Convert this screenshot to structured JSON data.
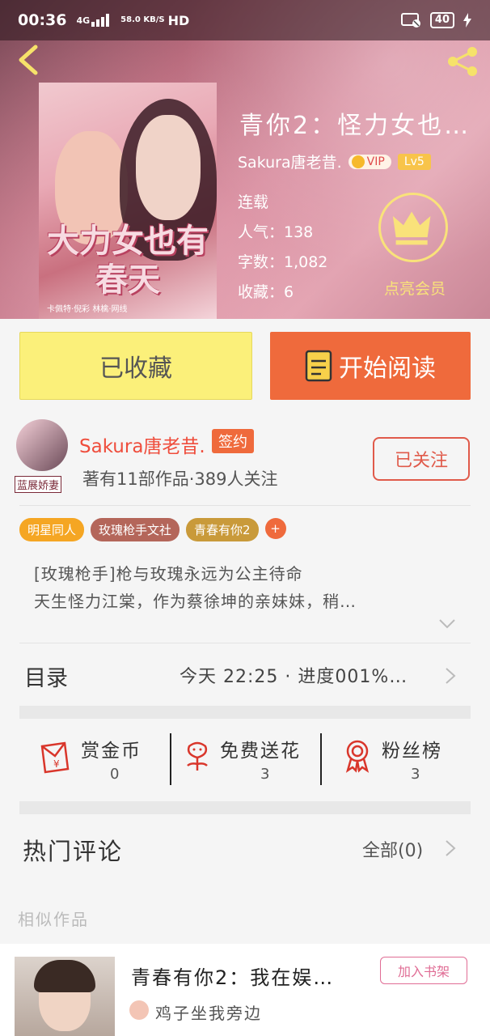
{
  "status_bar": {
    "time": "00:36",
    "network": "4G",
    "speed": "58.0 KB/S",
    "hd": "HD",
    "battery": "40"
  },
  "book": {
    "title": "青你2：怪力女也…",
    "cover_title": "大力女也有春天",
    "cover_credits": "卡佩特·倪彩   林檎·网线",
    "author": "Sakura唐老昔.",
    "vip_label": "VIP",
    "level": "Lv5",
    "status": "连载",
    "popularity": "人气：138",
    "word_count": "字数：1,082",
    "favorites": "收藏：6",
    "member_label": "点亮会员"
  },
  "actions": {
    "collected": "已收藏",
    "start_reading": "开始阅读"
  },
  "author_section": {
    "avatar_tag": "蓝展娇妻",
    "name": "Sakura唐老昔.",
    "signed": "签约",
    "stats": "著有11部作品·389人关注",
    "follow": "已关注"
  },
  "tags": [
    {
      "label": "明星同人",
      "color": "#f5a623"
    },
    {
      "label": "玫瑰枪手文社",
      "color": "#b4665a"
    },
    {
      "label": "青春有你2",
      "color": "#c99a3a"
    }
  ],
  "tag_plus": "+",
  "intro": {
    "line1": "[玫瑰枪手]枪与玫瑰永远为公主待命",
    "line2": "天生怪力江棠，作为蔡徐坤的亲妹妹，稍…"
  },
  "toc": {
    "label": "目录",
    "info": "今天 22:25 · 进度001%…"
  },
  "stats": [
    {
      "label": "赏金币",
      "value": "0",
      "icon": "red-envelope-icon"
    },
    {
      "label": "免费送花",
      "value": "3",
      "icon": "flower-icon"
    },
    {
      "label": "粉丝榜",
      "value": "3",
      "icon": "medal-icon"
    }
  ],
  "comments": {
    "label": "热门评论",
    "all": "全部(0)"
  },
  "similar": {
    "label": "相似作品",
    "title": "青春有你2：我在娱…",
    "add_shelf": "加入书架",
    "author": "鸡子坐我旁边"
  },
  "colors": {
    "accent": "#ef6a3c",
    "collected_bg": "#fbf07a",
    "follow": "#e05a4a",
    "member": "#f9e27a"
  }
}
